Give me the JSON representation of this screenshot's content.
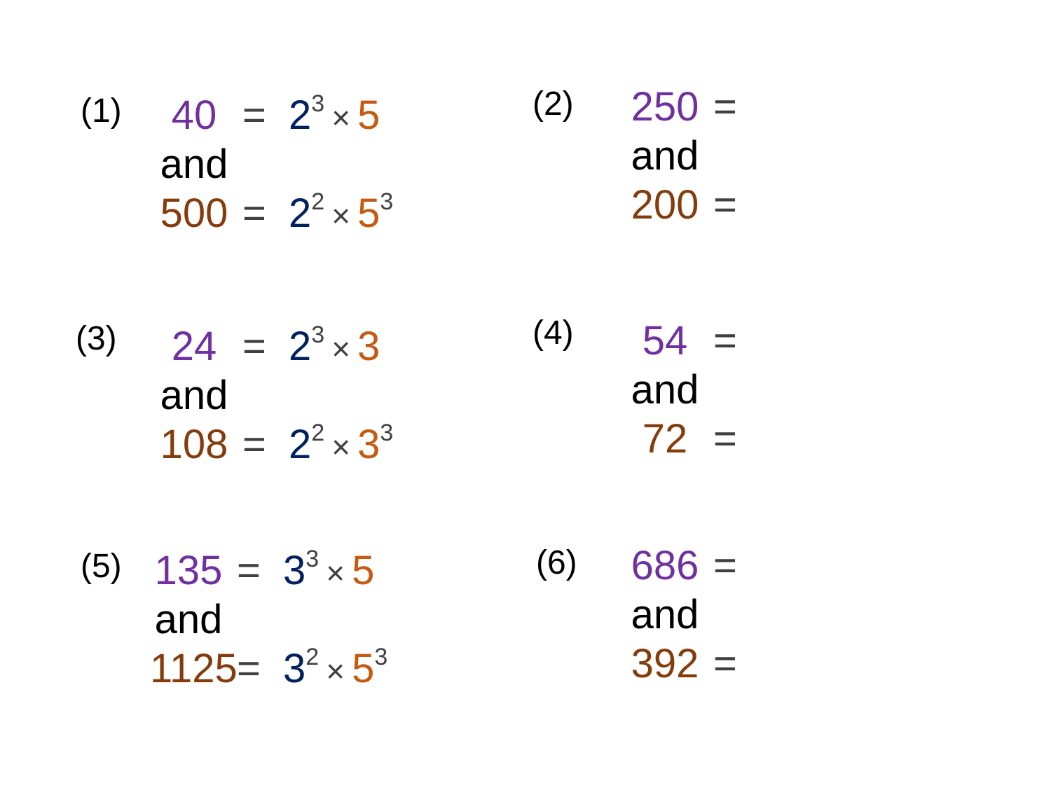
{
  "colors": {
    "first_number": "#7030a0",
    "second_number": "#843c0c",
    "prime_base_a": "#002060",
    "prime_base_b": "#c55a11",
    "operator": "#404040"
  },
  "and_label": "and",
  "equals": "=",
  "times": "×",
  "problems": [
    {
      "label": "(1)",
      "a": "40",
      "b": "500",
      "a_fact": {
        "p": "2",
        "pe": "3",
        "q": "5",
        "qe": ""
      },
      "b_fact": {
        "p": "2",
        "pe": "2",
        "q": "5",
        "qe": "3"
      }
    },
    {
      "label": "(2)",
      "a": "250",
      "b": "200"
    },
    {
      "label": "(3)",
      "a": "24",
      "b": "108",
      "a_fact": {
        "p": "2",
        "pe": "3",
        "q": "3",
        "qe": ""
      },
      "b_fact": {
        "p": "2",
        "pe": "2",
        "q": "3",
        "qe": "3"
      }
    },
    {
      "label": "(4)",
      "a": "54",
      "b": "72"
    },
    {
      "label": "(5)",
      "a": "135",
      "b": "1125",
      "a_fact": {
        "p": "3",
        "pe": "3",
        "q": "5",
        "qe": ""
      },
      "b_fact": {
        "p": "3",
        "pe": "2",
        "q": "5",
        "qe": "3"
      }
    },
    {
      "label": "(6)",
      "a": "686",
      "b": "392"
    }
  ]
}
